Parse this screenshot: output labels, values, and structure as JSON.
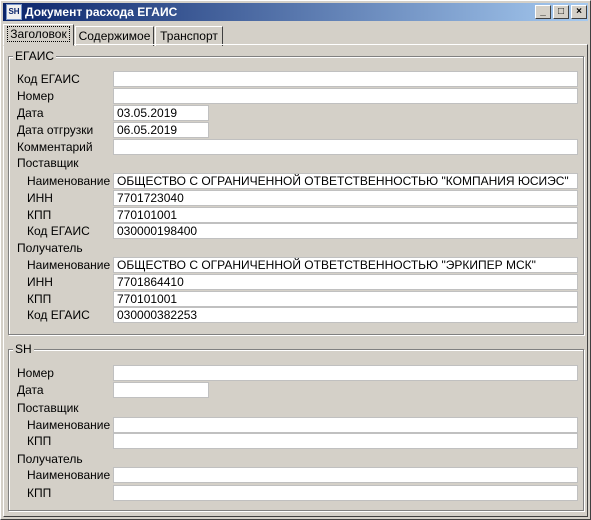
{
  "window": {
    "title": "Документ расхода ЕГАИС",
    "icon_text": "SH",
    "minimize": "_",
    "maximize": "□",
    "close": "×"
  },
  "tabs": [
    {
      "label": "Заголовок",
      "active": true
    },
    {
      "label": "Содержимое",
      "active": false
    },
    {
      "label": "Транспорт",
      "active": false
    }
  ],
  "egais": {
    "group_title": "ЕГАИС",
    "code_label": "Код ЕГАИС",
    "code_value": "",
    "number_label": "Номер",
    "number_value": "",
    "date_label": "Дата",
    "date_value": "03.05.2019",
    "ship_date_label": "Дата отгрузки",
    "ship_date_value": "06.05.2019",
    "comment_label": "Комментарий",
    "comment_value": "",
    "supplier": {
      "label": "Поставщик",
      "name_label": "Наименование",
      "name_value": "ОБЩЕСТВО С ОГРАНИЧЕННОЙ ОТВЕТСТВЕННОСТЬЮ \"КОМПАНИЯ ЮСИЭС\"",
      "inn_label": "ИНН",
      "inn_value": "7701723040",
      "kpp_label": "КПП",
      "kpp_value": "770101001",
      "code_label": "Код ЕГАИС",
      "code_value": "030000198400"
    },
    "recipient": {
      "label": "Получатель",
      "name_label": "Наименование",
      "name_value": "ОБЩЕСТВО С ОГРАНИЧЕННОЙ ОТВЕТСТВЕННОСТЬЮ \"ЭРКИПЕР МСК\"",
      "inn_label": "ИНН",
      "inn_value": "7701864410",
      "kpp_label": "КПП",
      "kpp_value": "770101001",
      "code_label": "Код ЕГАИС",
      "code_value": "030000382253"
    }
  },
  "sh": {
    "group_title": "SH",
    "number_label": "Номер",
    "number_value": "",
    "date_label": "Дата",
    "date_value": "",
    "supplier": {
      "label": "Поставщик",
      "name_label": "Наименование",
      "name_value": "",
      "kpp_label": "КПП",
      "kpp_value": ""
    },
    "recipient": {
      "label": "Получатель",
      "name_label": "Наименование",
      "name_value": "",
      "kpp_label": "КПП",
      "kpp_value": ""
    }
  }
}
